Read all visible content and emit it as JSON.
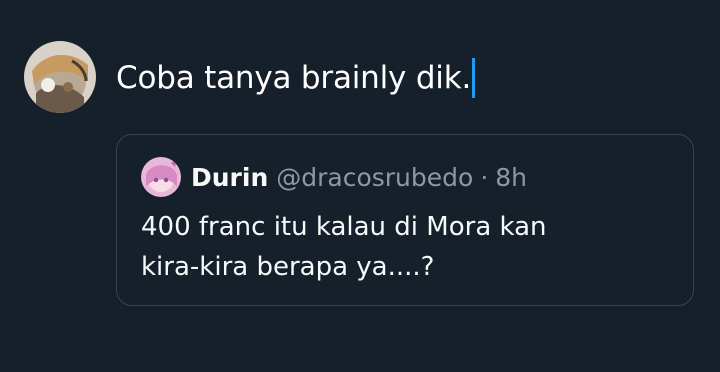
{
  "compose": {
    "text": "Coba tanya brainly dik."
  },
  "quote": {
    "display_name": "Durin",
    "handle": "@dracosrubedo",
    "separator": "·",
    "time": "8h",
    "lines": [
      "400 franc itu kalau di Mora kan",
      "kira-kira berapa ya....?"
    ]
  },
  "colors": {
    "background": "#16202b",
    "border": "#38444d",
    "muted_text": "#8b98a5",
    "caret": "#1d9bf0"
  },
  "icons": {
    "user_avatar": "user-avatar-image",
    "quoted_avatar": "quoted-user-avatar-image"
  }
}
